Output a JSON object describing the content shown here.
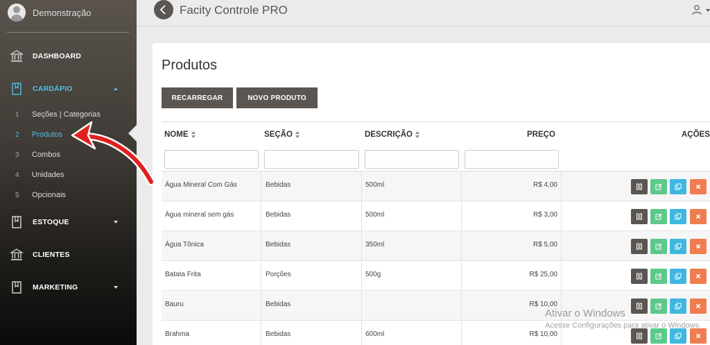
{
  "sidebar": {
    "username": "Demonstração",
    "menu": {
      "dashboard": "DASHBOARD",
      "cardapio": "CARDÁPIO",
      "estoque": "ESTOQUE",
      "clientes": "CLIENTES",
      "marketing": "MARKETING"
    },
    "submenu": [
      {
        "num": "1",
        "label": "Seções | Categorias"
      },
      {
        "num": "2",
        "label": "Produtos"
      },
      {
        "num": "3",
        "label": "Combos"
      },
      {
        "num": "4",
        "label": "Unidades"
      },
      {
        "num": "5",
        "label": "Opcionais"
      }
    ]
  },
  "header": {
    "title": "Facity Controle PRO"
  },
  "page": {
    "title": "Produtos",
    "reload_label": "RECARREGAR",
    "new_label": "NOVO PRODUTO"
  },
  "table": {
    "columns": {
      "nome": "NOME",
      "secao": "SEÇÃO",
      "descricao": "DESCRIÇÃO",
      "preco": "PREÇO",
      "acoes": "AÇÕES"
    },
    "rows": [
      {
        "nome": "Água Mineral Com Gás",
        "secao": "Bebidas",
        "descricao": "500ml",
        "preco": "R$ 4,00"
      },
      {
        "nome": "Àgua mineral sem gás",
        "secao": "Bebidas",
        "descricao": "500ml",
        "preco": "R$ 3,00"
      },
      {
        "nome": "Água Tônica",
        "secao": "Bebidas",
        "descricao": "350ml",
        "preco": "R$ 5,00"
      },
      {
        "nome": "Batata Frita",
        "secao": "Porções",
        "descricao": "500g",
        "preco": "R$ 25,00"
      },
      {
        "nome": "Bauru",
        "secao": "Bebidas",
        "descricao": "",
        "preco": "R$ 10,00"
      },
      {
        "nome": "Brahma",
        "secao": "Bebidas",
        "descricao": "600ml",
        "preco": "R$ 10,00"
      }
    ]
  },
  "watermark": {
    "line1": "Ativar o Windows",
    "line2": "Acesse Configurações para ativar o Windows."
  },
  "colors": {
    "accent": "#4fc1e9",
    "dark_button": "#5b5651",
    "edit": "#5cc98a",
    "copy": "#3fb7e0",
    "delete": "#ef7d4f",
    "annotation_arrow": "#e02020"
  }
}
